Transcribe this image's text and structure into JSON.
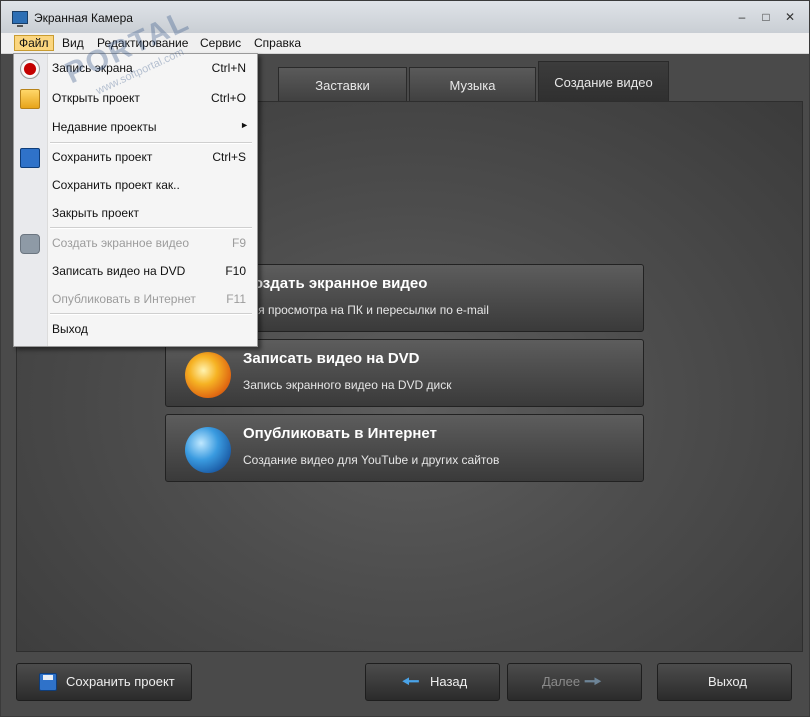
{
  "window": {
    "title": "Экранная Камера",
    "controls": [
      "–",
      "□",
      "✕"
    ]
  },
  "menubar": {
    "items": [
      "Файл",
      "Вид",
      "Редактирование",
      "Сервис",
      "Справка"
    ]
  },
  "tabs": [
    "Заставки",
    "Музыка",
    "Создание видео"
  ],
  "actions": [
    {
      "title": "Создать экранное видео",
      "subtitle": "Для просмотра на ПК и пересылки по e-mail"
    },
    {
      "title": "Записать видео на DVD",
      "subtitle": "Запись экранного видео на DVD диск"
    },
    {
      "title": "Опубликовать в Интернет",
      "subtitle": "Создание видео для YouTube и других сайтов"
    }
  ],
  "file_menu": {
    "items": [
      {
        "label": "Запись экрана",
        "shortcut": "Ctrl+N",
        "icon": "record-icon"
      },
      {
        "label": "Открыть проект",
        "shortcut": "Ctrl+O",
        "icon": "folder-icon"
      },
      {
        "label": "Недавние проекты",
        "shortcut": "",
        "submenu_arrow": "►"
      },
      {
        "label": "Сохранить проект",
        "shortcut": "Ctrl+S",
        "icon": "floppy-icon"
      },
      {
        "label": "Сохранить проект как..",
        "shortcut": ""
      },
      {
        "label": "Закрыть проект",
        "shortcut": ""
      },
      {
        "label": "Создать экранное видео",
        "shortcut": "F9",
        "icon": "camera-icon",
        "disabled": true
      },
      {
        "label": "Записать видео на DVD",
        "shortcut": "F10"
      },
      {
        "label": "Опубликовать в Интернет",
        "shortcut": "F11",
        "disabled": true
      },
      {
        "label": "Выход",
        "shortcut": ""
      }
    ]
  },
  "bottom": {
    "save": "Сохранить проект",
    "back": "Назад",
    "next": "Далее",
    "exit": "Выход"
  },
  "watermark": {
    "brand": "PORTAL",
    "site": "www.softportal.com"
  },
  "colors": {
    "menu_highlight": "#fbd67f",
    "panel_dark": "#3f3f3f",
    "arrow_blue": "#4aa3e8"
  }
}
